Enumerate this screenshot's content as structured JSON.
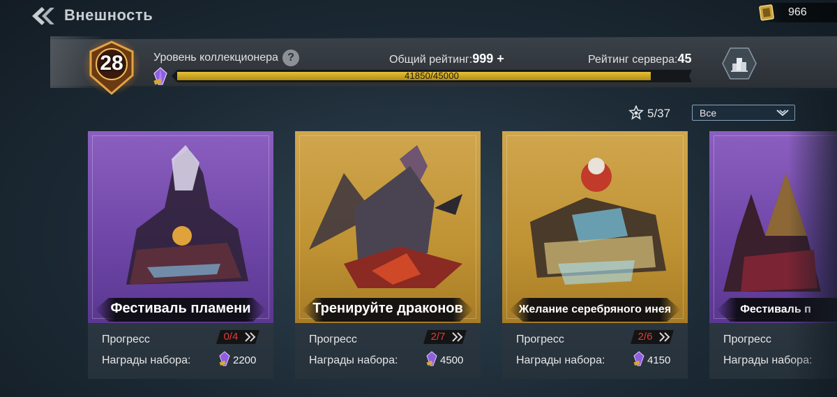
{
  "header": {
    "title": "Внешность",
    "currency": {
      "icon": "gold-ticket-icon",
      "value": "966"
    }
  },
  "collector": {
    "level": "28",
    "level_label": "Уровень коллекционера",
    "total_rating_label": "Общий рейтинг:",
    "total_rating_value": "999 +",
    "server_rating_label": "Рейтинг сервера:",
    "server_rating_value": "45",
    "progress_text": "41850/45000",
    "progress_fraction": 0.93
  },
  "filter": {
    "collected": "5/37",
    "selected": "Все"
  },
  "cards": [
    {
      "name": "Фестиваль пламени",
      "theme": "purple",
      "progress_label": "Прогресс",
      "progress": "0/4",
      "rewards_label": "Награды набора:",
      "reward": "2200"
    },
    {
      "name": "Тренируйте драконов",
      "theme": "gold",
      "progress_label": "Прогресс",
      "progress": "2/7",
      "rewards_label": "Награды набора:",
      "reward": "4500"
    },
    {
      "name": "Желание серебряного инея",
      "theme": "gold",
      "progress_label": "Прогресс",
      "progress": "2/6",
      "rewards_label": "Награды набора:",
      "reward": "4150"
    },
    {
      "name": "Фестиваль п",
      "theme": "purple",
      "progress_label": "Прогресс",
      "progress": "",
      "rewards_label": "Награды набора:",
      "reward": ""
    }
  ],
  "colors": {
    "accent_gold": "#d4ae30",
    "progress_red": "#e23b3b",
    "card_purple": "#7a50b3",
    "card_gold": "#c49a3e"
  }
}
